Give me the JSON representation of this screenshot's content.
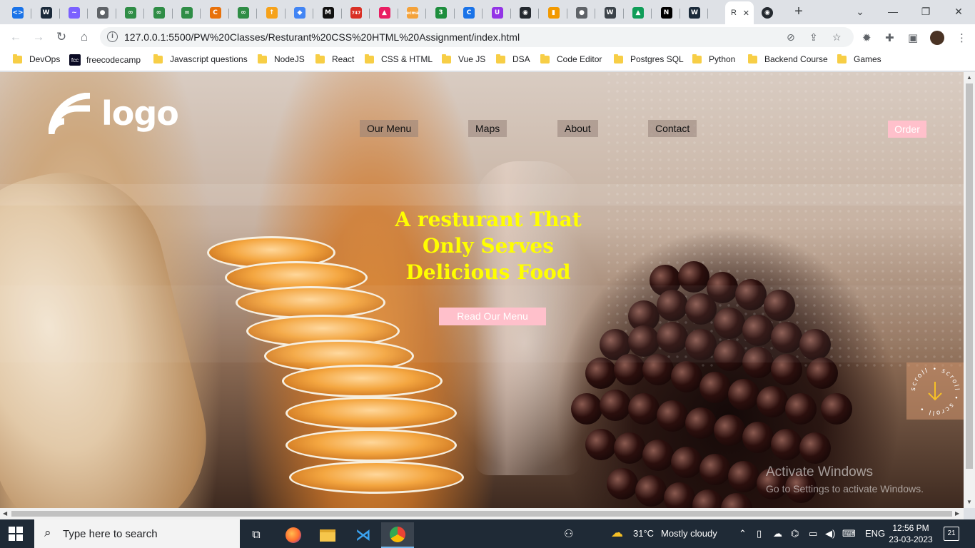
{
  "browser": {
    "active_tab_letter": "R",
    "url": "127.0.0.1:5500/PW%20Classes/Resturant%20CSS%20HTML%20Assignment/index.html",
    "tab_favicons": [
      {
        "icon": "code-icon",
        "color": "#1a73e8",
        "text": "<>"
      },
      {
        "icon": "webflow-icon",
        "color": "#1b2a3a",
        "text": "W"
      },
      {
        "icon": "wave-icon",
        "color": "#7b61ff",
        "text": "~"
      },
      {
        "icon": "globe-icon",
        "color": "#5f6368",
        "text": "●"
      },
      {
        "icon": "gfg-icon",
        "color": "#2f8d46",
        "text": "∞"
      },
      {
        "icon": "gfg-icon",
        "color": "#2f8d46",
        "text": "∞"
      },
      {
        "icon": "gfg-icon",
        "color": "#2f8d46",
        "text": "∞"
      },
      {
        "icon": "loader-icon",
        "color": "#e8710a",
        "text": "C"
      },
      {
        "icon": "gfg-icon",
        "color": "#2f8d46",
        "text": "∞"
      },
      {
        "icon": "hashnode-icon",
        "color": "#f6a21a",
        "text": "↑"
      },
      {
        "icon": "cube-icon",
        "color": "#4285f4",
        "text": "◆"
      },
      {
        "icon": "medium-icon",
        "color": "#111111",
        "text": "M"
      },
      {
        "icon": "747-icon",
        "color": "#d93025",
        "text": "747"
      },
      {
        "icon": "cube-red-icon",
        "color": "#e91e63",
        "text": "▲"
      },
      {
        "icon": "ecma-icon",
        "color": "#f4a23a",
        "text": "ecma"
      },
      {
        "icon": "three-icon",
        "color": "#1e8e3e",
        "text": "3"
      },
      {
        "icon": "c-icon",
        "color": "#1a73e8",
        "text": "C"
      },
      {
        "icon": "u-icon",
        "color": "#9334e6",
        "text": "U"
      },
      {
        "icon": "github-icon",
        "color": "#24292f",
        "text": "◉"
      },
      {
        "icon": "bookmark-icon",
        "color": "#f29900",
        "text": "▮"
      },
      {
        "icon": "globe-icon",
        "color": "#5f6368",
        "text": "●"
      },
      {
        "icon": "wordpress-icon",
        "color": "#3c434a",
        "text": "W"
      },
      {
        "icon": "drive-icon",
        "color": "#0f9d58",
        "text": "▲"
      },
      {
        "icon": "nextjs-icon",
        "color": "#000000",
        "text": "N"
      },
      {
        "icon": "webflow-icon",
        "color": "#1b2a3a",
        "text": "W"
      }
    ],
    "bookmarks": [
      {
        "label": "DevOps",
        "icon": "folder-icon"
      },
      {
        "label": "freecodecamp",
        "icon": "freecodecamp-icon"
      },
      {
        "label": "Javascript questions",
        "icon": "folder-icon"
      },
      {
        "label": "NodeJS",
        "icon": "folder-icon"
      },
      {
        "label": "React",
        "icon": "folder-icon"
      },
      {
        "label": "CSS & HTML",
        "icon": "folder-icon"
      },
      {
        "label": "Vue JS",
        "icon": "folder-icon"
      },
      {
        "label": "DSA",
        "icon": "folder-icon"
      },
      {
        "label": "Code Editor",
        "icon": "folder-icon"
      },
      {
        "label": "Postgres SQL",
        "icon": "folder-icon"
      },
      {
        "label": "Python",
        "icon": "folder-icon"
      },
      {
        "label": "Backend Course",
        "icon": "folder-icon"
      },
      {
        "label": "Games",
        "icon": "folder-icon"
      }
    ]
  },
  "site": {
    "logo_text": "logo",
    "nav": [
      "Our Menu",
      "Maps",
      "About",
      "Contact"
    ],
    "order_label": "Order",
    "headline": [
      "A resturant That",
      "Only Serves",
      "Delicious Food"
    ],
    "cta_label": "Read Our Menu",
    "scroll_badge_text": "scroll • scroll • scroll •",
    "colors": {
      "accent_pink": "#ffc0cb",
      "headline_yellow": "#ffff00"
    }
  },
  "watermark": {
    "line1": "Activate Windows",
    "line2": "Go to Settings to activate Windows."
  },
  "taskbar": {
    "search_placeholder": "Type here to search",
    "weather_temp": "31°C",
    "weather_desc": "Mostly cloudy",
    "language": "ENG",
    "time": "12:56 PM",
    "date": "23-03-2023",
    "notification_count": "21"
  }
}
